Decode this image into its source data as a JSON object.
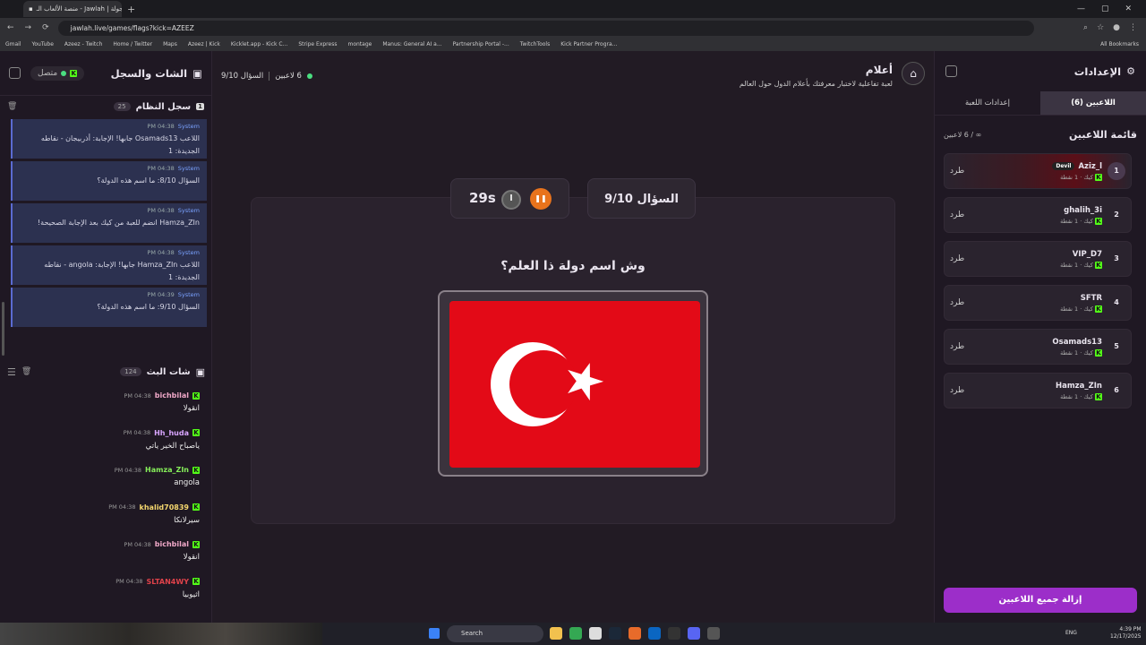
{
  "browser": {
    "tab_title": "منصة الألعاب الـ - Jawlah | جولة",
    "url": "jawlah.live/games/flags?kick=AZEEZ",
    "bookmarks": [
      "Gmail",
      "YouTube",
      "Azeez - Twitch",
      "Home / Twitter",
      "Maps",
      "Azeez | Kick",
      "Kicklet.app - Kick C...",
      "Stripe Express",
      "montage",
      "Manus: General AI a...",
      "Partnership Portal -...",
      "TwitchTools",
      "Kick Partner Progra..."
    ],
    "all_bookmarks": "All Bookmarks"
  },
  "left": {
    "title": "الشات والسجل",
    "status": "متصل",
    "system": {
      "title": "سجل النظام",
      "count": "25",
      "badge": "1",
      "items": [
        {
          "time": "PM 04:38",
          "sender": "System",
          "text": "اللاعب Osamads13 جابها! الإجابة: أذربيجان - نقاطه الجديدة: 1"
        },
        {
          "time": "PM 04:38",
          "sender": "System",
          "text": "السؤال 8/10: ما اسم هذه الدولة؟"
        },
        {
          "time": "PM 04:38",
          "sender": "System",
          "text": "Hamza_ZIn انضم للعبة من كيك بعد الإجابة الصحيحة!"
        },
        {
          "time": "PM 04:38",
          "sender": "System",
          "text": "اللاعب Hamza_ZIn جابها! الإجابة: angola - نقاطه الجديدة: 1"
        },
        {
          "time": "PM 04:39",
          "sender": "System",
          "text": "السؤال 9/10: ما اسم هذه الدولة؟"
        }
      ]
    },
    "chat": {
      "title": "شات البث",
      "count": "124",
      "items": [
        {
          "name": "bichbilal",
          "time": "PM 04:38",
          "text": "انقولا",
          "color": "#f0a8c8"
        },
        {
          "name": "Hh_huda",
          "time": "PM 04:38",
          "text": "ياصباح الخير ياتي",
          "color": "#d9a6ff"
        },
        {
          "name": "Hamza_ZIn",
          "time": "PM 04:38",
          "text": "angola",
          "color": "#86ef5a"
        },
        {
          "name": "khalid70839",
          "time": "PM 04:38",
          "text": "سيرلانكا",
          "color": "#f5d76e"
        },
        {
          "name": "bichbilal",
          "time": "PM 04:38",
          "text": "انقولا",
          "color": "#f0a8c8"
        },
        {
          "name": "SLTAN4WY",
          "time": "PM 04:38",
          "text": "اثيوبيا",
          "color": "#e0424a"
        }
      ]
    }
  },
  "game": {
    "title": "أعلام",
    "desc": "لعبة تفاعلية لاختبار معرفتك بأعلام الدول حول العالم",
    "players": "6 لاعبين",
    "question_short": "السؤال 9/10",
    "question_label": "السؤال 9/10",
    "timer": "29s",
    "question": "وش اسم دولة ذا العلم؟",
    "flag_colors": {
      "red": "#e30a17",
      "white": "#ffffff"
    }
  },
  "right": {
    "title": "الإعدادات",
    "tabs": [
      "اللاعبين (6)",
      "إعدادات اللعبة"
    ],
    "list_title": "قائمة اللاعبين",
    "list_count": "∞ / 6 لاعبين",
    "kick_label": "طرد",
    "remove_all": "إزالة جميع اللاعبين",
    "players": [
      {
        "rank": "1",
        "name": "Aziz_l",
        "tag": "Devil",
        "stats": "كيك · 1 نقطة"
      },
      {
        "rank": "2",
        "name": "ghalih_3i",
        "stats": "كيك · 1 نقطة"
      },
      {
        "rank": "3",
        "name": "VIP_D7",
        "stats": "كيك · 1 نقطة"
      },
      {
        "rank": "4",
        "name": "SFTR",
        "stats": "كيك · 1 نقطة"
      },
      {
        "rank": "5",
        "name": "Osamads13",
        "stats": "كيك · 1 نقطة"
      },
      {
        "rank": "6",
        "name": "Hamza_ZIn",
        "stats": "كيك · 1 نقطة"
      }
    ]
  },
  "taskbar": {
    "search": "Search",
    "lang": "ENG",
    "time": "4:39 PM",
    "date": "12/17/2025"
  }
}
